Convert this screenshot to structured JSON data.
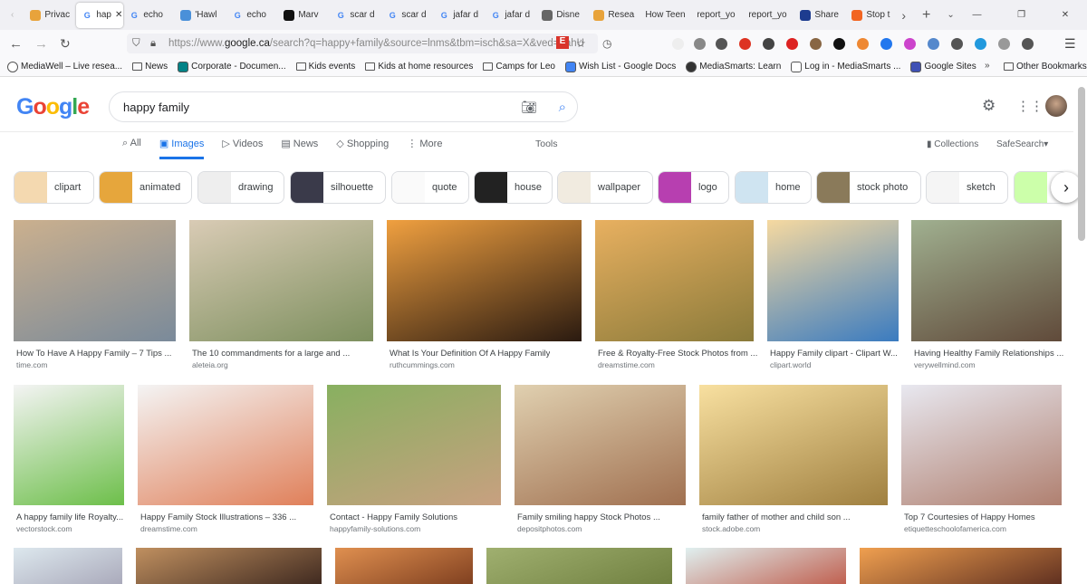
{
  "browser": {
    "tabs": [
      {
        "label": "Privac",
        "icon": "folder-icon",
        "color": "#e8a33b"
      },
      {
        "label": "hap",
        "icon": "google-icon",
        "color": "#4285f4",
        "active": true
      },
      {
        "label": "echo",
        "icon": "google-icon",
        "color": "#4285f4"
      },
      {
        "label": "'Hawl",
        "icon": "tv-icon",
        "color": "#4a90d9"
      },
      {
        "label": "echo",
        "icon": "google-icon",
        "color": "#4285f4"
      },
      {
        "label": "Marv",
        "icon": "d-icon",
        "color": "#111"
      },
      {
        "label": "scar d",
        "icon": "google-icon",
        "color": "#4285f4"
      },
      {
        "label": "scar d",
        "icon": "google-icon",
        "color": "#4285f4"
      },
      {
        "label": "jafar d",
        "icon": "google-icon",
        "color": "#4285f4"
      },
      {
        "label": "jafar d",
        "icon": "google-icon",
        "color": "#4285f4"
      },
      {
        "label": "Disne",
        "icon": "disney-icon",
        "color": "#666"
      },
      {
        "label": "Resea",
        "icon": "folder-icon",
        "color": "#e8a33b"
      },
      {
        "label": "How Teen",
        "icon": "",
        "color": ""
      },
      {
        "label": "report_yo",
        "icon": "",
        "color": ""
      },
      {
        "label": "report_yo",
        "icon": "",
        "color": ""
      },
      {
        "label": "Share",
        "icon": "s-icon",
        "color": "#1d3c8f"
      },
      {
        "label": "Stop t",
        "icon": "orange-icon",
        "color": "#f26522"
      }
    ],
    "url_prefix": "https://www.",
    "url_domain": "google.ca",
    "url_rest": "/search?q=happy+family&source=lnms&tbm=isch&sa=X&ved=2ahU",
    "bookmarks": [
      {
        "label": "MediaWell – Live resea...",
        "icon": "globe-icon"
      },
      {
        "label": "News",
        "icon": "folder-icon"
      },
      {
        "label": "Corporate - Documen...",
        "icon": "sharepoint-icon"
      },
      {
        "label": "Kids events",
        "icon": "folder-icon"
      },
      {
        "label": "Kids at home resources",
        "icon": "folder-icon"
      },
      {
        "label": "Camps for Leo",
        "icon": "folder-icon"
      },
      {
        "label": "Wish List - Google Docs",
        "icon": "docs-icon"
      },
      {
        "label": "MediaSmarts: Learn",
        "icon": "m-icon"
      },
      {
        "label": "Log in - MediaSmarts ...",
        "icon": "t-icon"
      },
      {
        "label": "Google Sites",
        "icon": "sites-icon"
      }
    ],
    "other_bookmarks": "Other Bookmarks"
  },
  "google": {
    "logo": "Google",
    "query": "happy family",
    "tabs": [
      "All",
      "Images",
      "Videos",
      "News",
      "Shopping",
      "More"
    ],
    "tools": "Tools",
    "collections": "Collections",
    "safesearch": "SafeSearch",
    "chips": [
      "clipart",
      "animated",
      "drawing",
      "silhouette",
      "quote",
      "house",
      "wallpaper",
      "logo",
      "home",
      "stock photo",
      "sketch"
    ],
    "results": [
      [
        {
          "title": "How To Have A Happy Family – 7 Tips ...",
          "source": "time.com"
        },
        {
          "title": "The 10 commandments for a large and ...",
          "source": "aleteia.org"
        },
        {
          "title": "What Is Your Definition Of A Happy Family",
          "source": "ruthcummings.com"
        },
        {
          "title": "Free & Royalty-Free Stock Photos from ...",
          "source": "dreamstime.com"
        },
        {
          "title": "Happy Family clipart - Clipart W...",
          "source": "clipart.world"
        },
        {
          "title": "Having Healthy Family Relationships ...",
          "source": "verywellmind.com"
        }
      ],
      [
        {
          "title": "A happy family life Royalty...",
          "source": "vectorstock.com"
        },
        {
          "title": "Happy Family Stock Illustrations – 336 ...",
          "source": "dreamstime.com"
        },
        {
          "title": "Contact - Happy Family Solutions",
          "source": "happyfamily-solutions.com"
        },
        {
          "title": "Family smiling happy Stock Photos ...",
          "source": "depositphotos.com"
        },
        {
          "title": "family father of mother and child son ...",
          "source": "stock.adobe.com"
        },
        {
          "title": "Top 7 Courtesies of Happy Homes",
          "source": "etiquetteschoolofamerica.com"
        }
      ]
    ]
  }
}
